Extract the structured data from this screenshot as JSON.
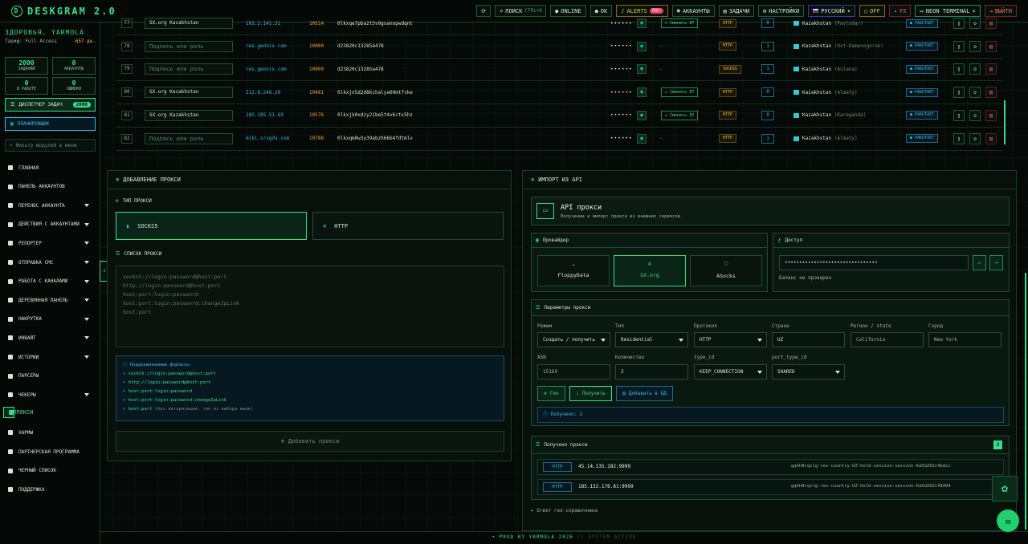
{
  "app": {
    "title": "DESKGRAM 2.0"
  },
  "topbar": {
    "search": "ПОИСК",
    "search_kbd": "CTRL+K",
    "online": "ONLINE",
    "ok": "OK",
    "alerts": "ALERTS",
    "alerts_count": "99+",
    "accounts": "АККАУНТЫ",
    "tasks": "ЗАДАЧИ",
    "settings": "НАСТРОЙКИ",
    "lang": "РУССКИЙ",
    "off": "OFF",
    "fx": "FX",
    "terminal": "NEON TERMINAL",
    "logout": "ВЫЙТИ"
  },
  "sidebar": {
    "user": "ЗДОРОВЬЯ, YARMOLA",
    "plan_label": "Тариф: Full Access",
    "plan_days": "657 дн.",
    "stats": [
      {
        "n": "2000",
        "l": "ЗАДАНИЙ"
      },
      {
        "n": "0",
        "l": "АККАУНТЫ"
      },
      {
        "n": "0",
        "l": "В РАБОТЕ"
      },
      {
        "n": "0",
        "l": "ОШИБКИ"
      }
    ],
    "dispatcher": "ДИСПЕТЧЕР ЗАДАЧ",
    "dispatcher_badge": "2000",
    "planner": "ПЛАНИРОВЩИК",
    "filter_placeholder": "Фильтр модулей в меню",
    "items": [
      "ГЛАВНАЯ",
      "ПАНЕЛЬ АККАУНТОВ",
      "ПЕРЕНОС АККАУНТА",
      "ДЕЙСТВИЯ С АККАУНТАМИ",
      "РЕПОРТЕР",
      "ОТПРАВКА СМС",
      "РАБОТА С КАНАЛАМИ",
      "ДЕРЕВЯННАЯ ПАНЕЛЬ",
      "НАКРУТКА",
      "ИНВАЙТ",
      "ИСТОРИИ",
      "ПАРСЕРЫ",
      "ЧЕКЕРЫ",
      "ПРОКСИ",
      "ХАРМЫ",
      "ПАРТНЕРСКАЯ ПРОГРАММА",
      "ЧЕРНЫЙ СПИСОК",
      "ПОДДЕРЖКА"
    ]
  },
  "table": {
    "rows": [
      {
        "n": "77",
        "name": "SX.org Kazakhstan",
        "ph": false,
        "ip": "193.2.141.31",
        "port": "10514",
        "login": "0lkxqe7pba2t5v9gsanopwdqnt",
        "change": "Сменить IP",
        "proto": "HTTP",
        "cnt": "0",
        "country": "Kazakhstan",
        "city": "(Pavlodar)",
        "status": "РАБОТАЕТ"
      },
      {
        "n": "78",
        "name": "Подпись или роль",
        "ph": true,
        "ip": "res.geonix.com",
        "port": "10000",
        "login": "d23820c13285a478",
        "change": "",
        "proto": "HTTP",
        "cnt": "1",
        "country": "Kazakhstan",
        "city": "(Ust-Kamenogorsk)",
        "status": "РАБОТАЕТ"
      },
      {
        "n": "79",
        "name": "Подпись или роль",
        "ph": true,
        "ip": "res.geonix.com",
        "port": "10000",
        "login": "d23820c13285a478",
        "change": "",
        "proto": "SOCKS5",
        "cnt": "1",
        "country": "Kazakhstan",
        "city": "(Astana)",
        "status": "РАБОТАЕТ"
      },
      {
        "n": "80",
        "name": "SX.org Kazakhstan",
        "ph": false,
        "ip": "212.8.248.20",
        "port": "10481",
        "login": "0lkxjn5d2d8kchalya09mtfvke",
        "change": "Сменить IP",
        "proto": "HTTP",
        "cnt": "0",
        "country": "Kazakhstan",
        "city": "(Almaty)",
        "status": "РАБОТАЕТ"
      },
      {
        "n": "81",
        "name": "SX.org Kazakhstan",
        "ph": false,
        "ip": "185.185.51.69",
        "port": "10576",
        "login": "0lkxjk0xdzy21be5t4v6ctx5hz",
        "change": "Сменить IP",
        "proto": "HTTP",
        "cnt": "0",
        "country": "Kazakhstan",
        "city": "(Karaganda)",
        "status": "РАБОТАЕТ"
      },
      {
        "n": "82",
        "name": "Подпись или роль",
        "ph": true,
        "ip": "miki.srvgdx.com",
        "port": "10788",
        "login": "0lkxqm0w3y39abzh66b4fdtmlv",
        "change": "",
        "proto": "HTTP",
        "cnt": "1",
        "country": "Kazakhstan",
        "city": "(Almaty)",
        "status": "РАБОТАЕТ"
      }
    ]
  },
  "add": {
    "title": "ДОБАВЛЕНИЕ ПРОКСИ",
    "type_label": "ТИП ПРОКСИ",
    "socks": "SOCKS5",
    "http": "HTTP",
    "list_label": "СПИСОК ПРОКСИ",
    "placeholder_lines": [
      "socks5://login:password@host:port",
      "http://login:password@host:port",
      "host:port:login:password",
      "host:port:login:password:changeIpLink",
      "host:port"
    ],
    "formats_title": "Поддерживаемые форматы:",
    "formats": [
      "socks5://login:password@host:port",
      "http://login:password@host:port",
      "host:port:login:password",
      "host:port:login:password:changeIpLink",
      "host:port"
    ],
    "formats_note": "(без авторизации, тип из выбора выше)",
    "submit": "Добавить прокси"
  },
  "import": {
    "title": "ИМПОРТ ИЗ API",
    "api_title": "API прокси",
    "api_sub": "Получение и импорт прокси из внешних сервисов",
    "provider_label": "Провайдер",
    "providers": [
      "FloppyData",
      "SX.org",
      "ASocks"
    ],
    "access_label": "Доступ",
    "key_value": "••••••••••••••••••••••••••••••••",
    "balance": "Баланс не проверен",
    "params_label": "Параметры прокси",
    "f_mode": "Режим",
    "v_mode": "Создать / получить",
    "f_type": "Тип",
    "v_type": "Residential",
    "f_proto": "Протокол",
    "v_proto": "HTTP",
    "f_country": "Страна",
    "v_country": "UZ",
    "f_region": "Регион / state",
    "v_region": "California",
    "f_city": "Город",
    "v_city": "New York",
    "f_asn": "ASN",
    "v_asn": "15169",
    "f_count": "Количество",
    "v_count": "2",
    "f_typeid": "type_id",
    "v_typeid": "KEEP_CONNECTION",
    "f_porttype": "port_type_id",
    "v_porttype": "SHARED",
    "btn_geo": "Гео",
    "btn_get": "Получить",
    "btn_db": "Добавить в БД",
    "received_note": "Получено: 2",
    "received_title": "Получено прокси",
    "received_count": "2",
    "received": [
      {
        "proto": "HTTP",
        "addr": "45.14.135.182:9999",
        "cred": "gqhh8rqclg-res-country-UZ-hold-session-session-6a5d292c4bdcc"
      },
      {
        "proto": "HTTP",
        "addr": "185.132.176.81:9999",
        "cred": "gqhh8rqclg-res-country-UZ-hold-session-session-6a5d292c49d94"
      }
    ],
    "geo_ref": "Ответ гео-справочника"
  },
  "footer": {
    "text": "PROD BY YARMOLA 2026",
    "sub": "// SYSTEM ACTIVE"
  }
}
